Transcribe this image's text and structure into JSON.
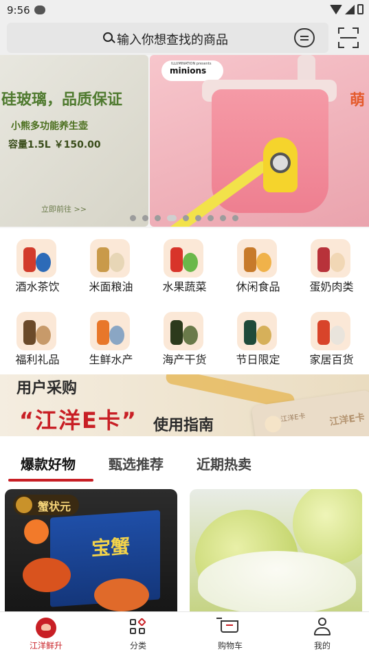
{
  "status_bar": {
    "time": "9:56"
  },
  "search": {
    "placeholder": "输入你想查找的商品"
  },
  "banner": {
    "left_slide": {
      "title": "硅玻璃，品质保证",
      "subtitle": "小熊多功能养生壶",
      "meta": "容量1.5L  ￥150.00",
      "link": "立即前往 >>"
    },
    "right_slide": {
      "brand": "minions",
      "brand_small": "ILLUMINATION presents",
      "edge_text": "萌"
    },
    "dot_count": 9,
    "active_dot": 3
  },
  "categories": [
    {
      "label": "酒水茶饮",
      "icon": "drinks-icon",
      "c1": "#d23b2b",
      "c2": "#2d6bb8"
    },
    {
      "label": "米面粮油",
      "icon": "grain-oil-icon",
      "c1": "#c99a4a",
      "c2": "#e7d6b6"
    },
    {
      "label": "水果蔬菜",
      "icon": "fruit-veg-icon",
      "c1": "#d8342a",
      "c2": "#6ab84a"
    },
    {
      "label": "休闲食品",
      "icon": "snacks-icon",
      "c1": "#c77a2a",
      "c2": "#f0b24a"
    },
    {
      "label": "蛋奶肉类",
      "icon": "meat-egg-icon",
      "c1": "#b8323a",
      "c2": "#f1d7b5"
    },
    {
      "label": "福利礼品",
      "icon": "gift-icon",
      "c1": "#6b4a2a",
      "c2": "#c79a6a"
    },
    {
      "label": "生鲜水产",
      "icon": "seafood-icon",
      "c1": "#e8772a",
      "c2": "#8aa6c4"
    },
    {
      "label": "海产干货",
      "icon": "dried-seafood-icon",
      "c1": "#2c3a1c",
      "c2": "#6a7a4a"
    },
    {
      "label": "节日限定",
      "icon": "festival-icon",
      "c1": "#1f4a3a",
      "c2": "#d6b05a"
    },
    {
      "label": "家居百货",
      "icon": "home-goods-icon",
      "c1": "#d8442a",
      "c2": "#e9e4dc"
    }
  ],
  "promo": {
    "title": "用户采购",
    "card_name": "“江洋E卡”",
    "guide": "使用指南",
    "card_label": "江洋E卡",
    "card_label2": "江洋E卡"
  },
  "tabs": [
    {
      "label": "爆款好物",
      "active": true
    },
    {
      "label": "甄选推荐",
      "active": false
    },
    {
      "label": "近期热卖",
      "active": false
    }
  ],
  "products": {
    "p1": {
      "brand": "蟹状元",
      "box_text": "宝蟹"
    },
    "p2": {}
  },
  "bottom_nav": [
    {
      "label": "江洋鲜升",
      "active": true
    },
    {
      "label": "分类",
      "active": false
    },
    {
      "label": "购物车",
      "active": false
    },
    {
      "label": "我的",
      "active": false
    }
  ],
  "colors": {
    "accent": "#c81f25",
    "brand_green": "#4f7a2f"
  }
}
